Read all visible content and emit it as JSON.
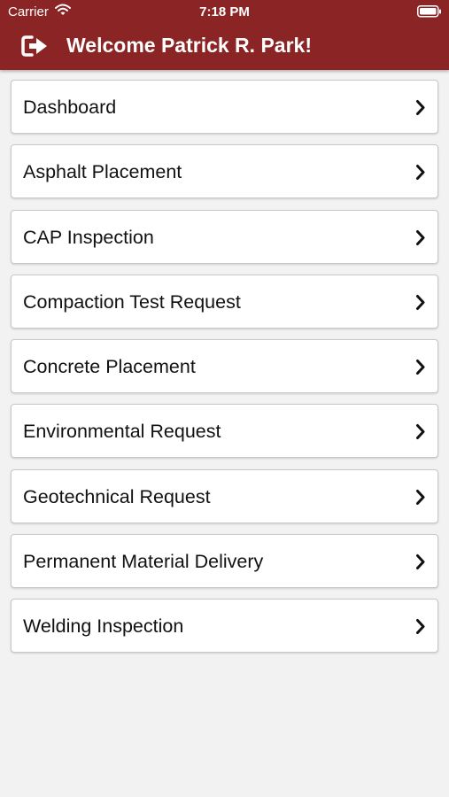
{
  "status_bar": {
    "carrier": "Carrier",
    "time": "7:18 PM",
    "icons": [
      "wifi-icon",
      "battery-icon"
    ]
  },
  "header": {
    "title": "Welcome Patrick R. Park!",
    "icon": "logout-icon",
    "background_color": "#8b2424"
  },
  "menu": {
    "items": [
      {
        "label": "Dashboard"
      },
      {
        "label": "Asphalt Placement"
      },
      {
        "label": "CAP Inspection"
      },
      {
        "label": "Compaction Test Request"
      },
      {
        "label": "Concrete Placement"
      },
      {
        "label": "Environmental Request"
      },
      {
        "label": "Geotechnical Request"
      },
      {
        "label": "Permanent Material Delivery"
      },
      {
        "label": "Welding Inspection"
      }
    ],
    "item_icon": "chevron-right-icon"
  }
}
